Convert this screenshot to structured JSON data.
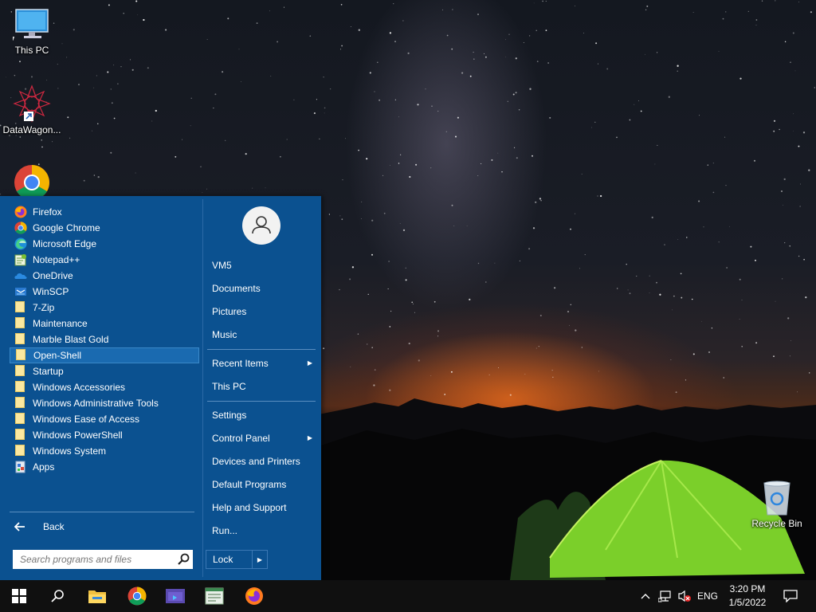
{
  "desktop": {
    "icons": [
      {
        "label": "This PC"
      },
      {
        "label": "DataWagon..."
      },
      {
        "label": "Recycle Bin"
      }
    ]
  },
  "start_menu": {
    "programs": [
      {
        "label": "Firefox",
        "icon": "firefox-icon"
      },
      {
        "label": "Google Chrome",
        "icon": "chrome-icon"
      },
      {
        "label": "Microsoft Edge",
        "icon": "edge-icon"
      },
      {
        "label": "Notepad++",
        "icon": "notepad-plus-plus-icon"
      },
      {
        "label": "OneDrive",
        "icon": "onedrive-icon"
      },
      {
        "label": "WinSCP",
        "icon": "winscp-icon"
      },
      {
        "label": "7-Zip",
        "icon": "folder-icon"
      },
      {
        "label": "Maintenance",
        "icon": "folder-icon"
      },
      {
        "label": "Marble Blast Gold",
        "icon": "folder-icon"
      },
      {
        "label": "Open-Shell",
        "icon": "folder-icon",
        "selected": true
      },
      {
        "label": "Startup",
        "icon": "folder-icon"
      },
      {
        "label": "Windows Accessories",
        "icon": "folder-icon"
      },
      {
        "label": "Windows Administrative Tools",
        "icon": "folder-icon"
      },
      {
        "label": "Windows Ease of Access",
        "icon": "folder-icon"
      },
      {
        "label": "Windows PowerShell",
        "icon": "folder-icon"
      },
      {
        "label": "Windows System",
        "icon": "folder-icon"
      },
      {
        "label": "Apps",
        "icon": "apps-icon"
      }
    ],
    "back_label": "Back",
    "search_placeholder": "Search programs and files",
    "right_items": [
      {
        "label": "VM5"
      },
      {
        "label": "Documents"
      },
      {
        "label": "Pictures"
      },
      {
        "label": "Music"
      },
      {
        "label": "Recent Items",
        "submenu": true
      },
      {
        "label": "This PC"
      },
      {
        "label": "Settings"
      },
      {
        "label": "Control Panel",
        "submenu": true
      },
      {
        "label": "Devices and Printers"
      },
      {
        "label": "Default Programs"
      },
      {
        "label": "Help and Support"
      },
      {
        "label": "Run..."
      }
    ],
    "lock_label": "Lock"
  },
  "taskbar": {
    "language": "ENG",
    "time": "3:20 PM",
    "date": "1/5/2022"
  },
  "colors": {
    "menu_bg": "#0b5190",
    "taskbar_bg": "#101010",
    "selection": "#1a6ab0"
  }
}
